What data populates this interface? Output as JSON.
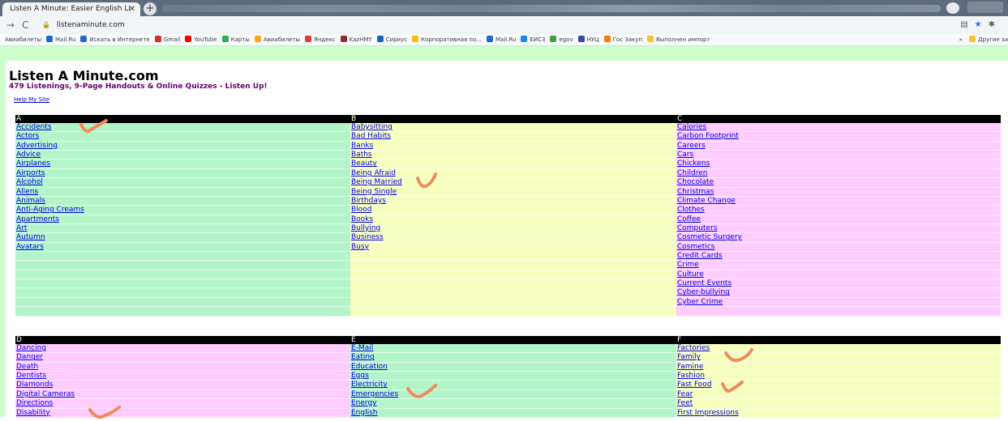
{
  "browser": {
    "tab_title": "Listen A Minute: Easier English Li",
    "tab_close": "✕",
    "new_tab": "+",
    "url": "listenaminute.com",
    "bookmarks": [
      {
        "label": "Авиабилеты",
        "color": ""
      },
      {
        "label": "Mail.Ru",
        "color": "#1e6cc8"
      },
      {
        "label": "Искать в Интернете",
        "color": "#1e6cc8"
      },
      {
        "label": "Gmail",
        "color": "#d93025"
      },
      {
        "label": "YouTube",
        "color": "#ff0000"
      },
      {
        "label": "Карты",
        "color": "#34a853"
      },
      {
        "label": "Авиабилеты",
        "color": "#f9a825"
      },
      {
        "label": "Яндекс",
        "color": "#e53935"
      },
      {
        "label": "KazHMY",
        "color": "#8e2a2a"
      },
      {
        "label": "Сириус",
        "color": "#1565c0"
      },
      {
        "label": "Корпоративная по...",
        "color": "#fbbc04"
      },
      {
        "label": "Mail.Ru",
        "color": "#1e6cc8"
      },
      {
        "label": "ЕИСЗ",
        "color": "#1e88e5"
      },
      {
        "label": "egov",
        "color": "#43a047"
      },
      {
        "label": "НУЦ",
        "color": "#3949ab"
      },
      {
        "label": "Гос Закуп",
        "color": "#f57c00"
      },
      {
        "label": "Выполнен импорт",
        "color": "#fbc02d"
      }
    ],
    "bookmarks_more": "»",
    "other_bookmarks": "Другие за"
  },
  "site": {
    "title": "Listen A Minute.com",
    "subtitle": "479 Listenings, 9-Page Handouts & Online Quizzes - Listen Up!",
    "help_link": "Help My Site"
  },
  "sections": [
    {
      "letter": "A",
      "color": "#b3f5c9",
      "items": [
        "Accidents",
        "Actors",
        "Advertising",
        "Advice",
        "Airplanes",
        "Airports",
        "Alcohol",
        "Aliens",
        "Animals",
        "Anti-Aging Creams",
        "Apartments",
        "Art",
        "Autumn",
        "Avatars",
        "",
        "",
        "",
        "",
        "",
        "",
        ""
      ]
    },
    {
      "letter": "B",
      "color": "#f7ffbf",
      "items": [
        "Babysitting",
        "Bad Habits",
        "Banks",
        "Baths",
        "Beauty",
        "Being Afraid",
        "Being Married",
        "Being Single",
        "Birthdays",
        "Blood",
        "Books",
        "Bullying",
        "Business",
        "Busy",
        "",
        "",
        "",
        "",
        "",
        "",
        ""
      ]
    },
    {
      "letter": "C",
      "color": "#ffccff",
      "items": [
        "Calories",
        "Carbon Footprint",
        "Careers",
        "Cars",
        "Chickens",
        "Children",
        "Chocolate",
        "Christmas",
        "Climate Change",
        "Clothes",
        "Coffee",
        "Computers",
        "Cosmetic Surgery",
        "Cosmetics",
        "Credit Cards",
        "Crime",
        "Culture",
        "Current Events",
        "Cyber-bullying",
        "Cyber Crime",
        ""
      ]
    },
    {
      "letter": "D",
      "color": "#ffccff",
      "items": [
        "Dancing",
        "Danger",
        "Death",
        "Dentists",
        "Diamonds",
        "Digital Cameras",
        "Directions",
        "Disability"
      ]
    },
    {
      "letter": "E",
      "color": "#b3f5c9",
      "items": [
        "E-Mail",
        "Eating",
        "Education",
        "Eggs",
        "Electricity",
        "Emergencies",
        "Energy",
        "English"
      ]
    },
    {
      "letter": "F",
      "color": "#f7ffbf",
      "items": [
        "Factories",
        "Family",
        "Famine",
        "Fashion",
        "Fast Food",
        "Fear",
        "Feet",
        "First Impressions"
      ]
    }
  ],
  "annotation_color": "#f08a5d"
}
